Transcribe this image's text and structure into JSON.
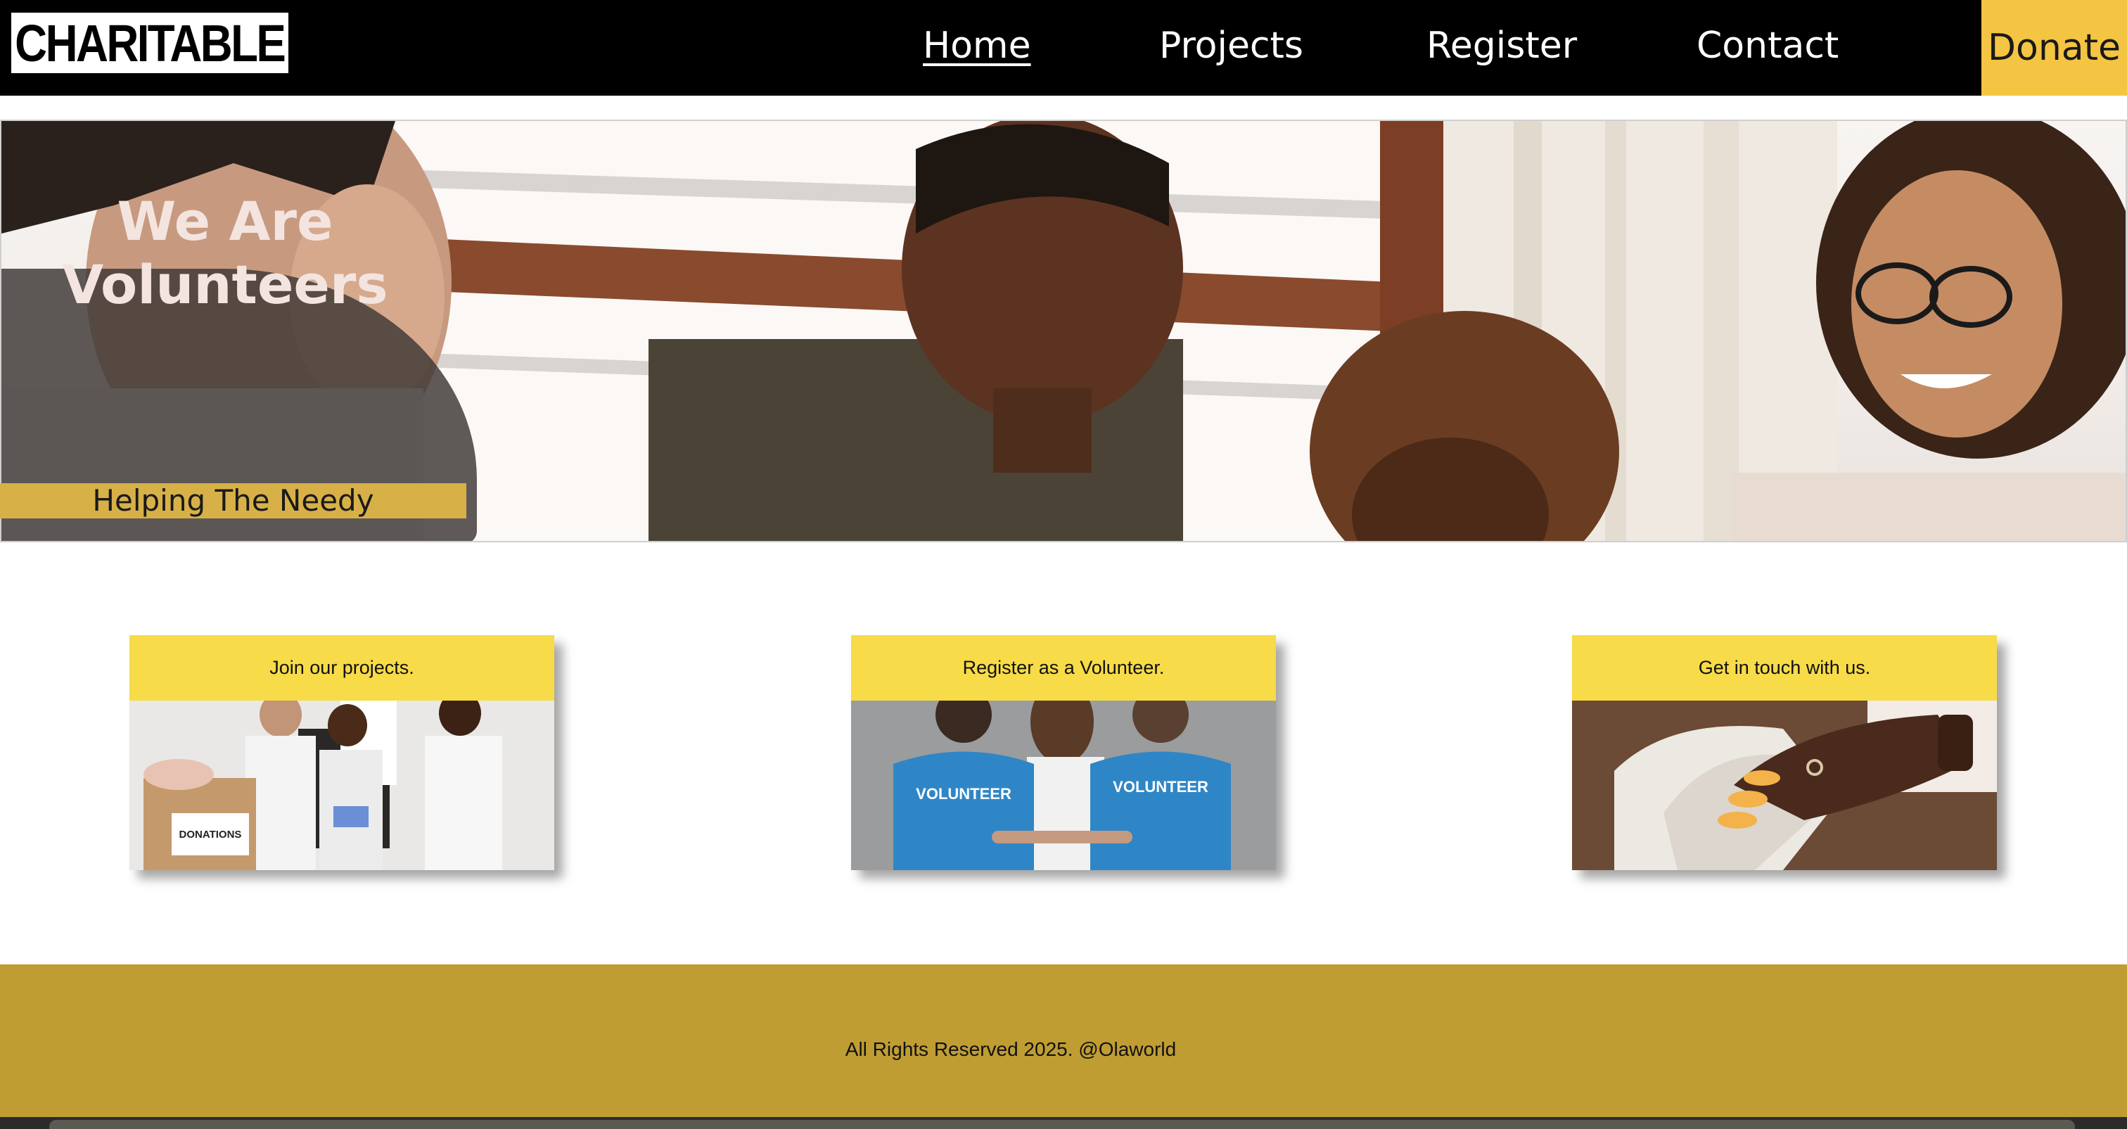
{
  "brand": {
    "logo_text": "CHARITABLE"
  },
  "nav": {
    "items": [
      {
        "label": "Home",
        "active": true
      },
      {
        "label": "Projects",
        "active": false
      },
      {
        "label": "Register",
        "active": false
      },
      {
        "label": "Contact",
        "active": false
      }
    ],
    "donate_label": "Donate"
  },
  "hero": {
    "title": "We Are Volunteers",
    "subtitle": "Helping The Needy"
  },
  "cards": [
    {
      "title": "Join our projects.",
      "image": "volunteers-packing-donations"
    },
    {
      "title": "Register as a Volunteer.",
      "image": "volunteers-blue-shirts",
      "shirt_text": "VOLUNTEER"
    },
    {
      "title": "Get in touch with us.",
      "image": "hand-on-telephone"
    }
  ],
  "donations_box_text": "DONATIONS",
  "footer": {
    "text": "All Rights Reserved 2025. @Olaworld"
  },
  "colors": {
    "nav_bg": "#000000",
    "donate_bg": "#f4c542",
    "card_header": "#f7db48",
    "footer_bg": "#c09d33",
    "hero_band": "#d7b148"
  }
}
